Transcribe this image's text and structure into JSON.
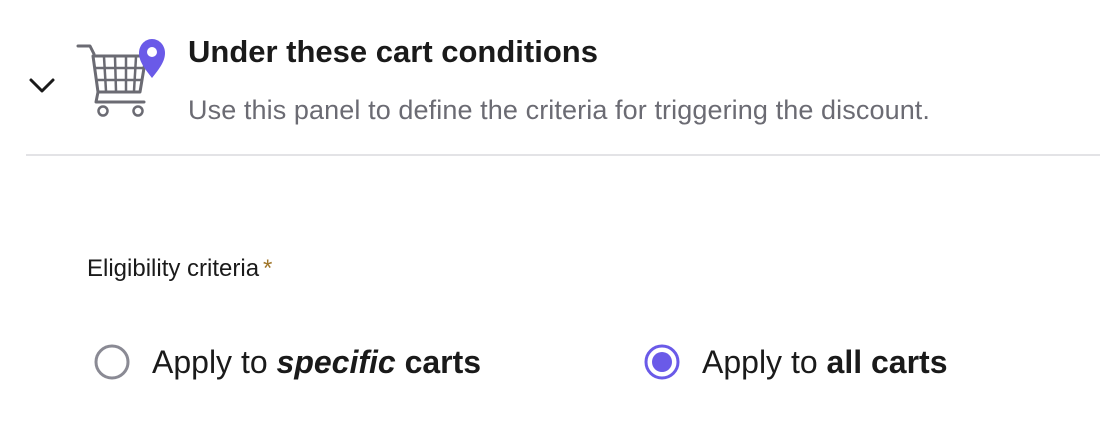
{
  "section": {
    "title": "Under these cart conditions",
    "subtitle": "Use this panel to define the criteria for triggering the discount.",
    "expanded": true,
    "icon": "shopping-cart-location-icon",
    "toggle_icon": "chevron-down-icon"
  },
  "eligibility": {
    "label": "Eligibility criteria",
    "required_mark": "*",
    "options": [
      {
        "id": "specific",
        "prefix": "Apply to ",
        "emphasis": "specific",
        "suffix": " carts",
        "selected": false
      },
      {
        "id": "all",
        "prefix": "Apply to ",
        "emphasis": "all carts",
        "suffix": "",
        "selected": true
      }
    ]
  },
  "colors": {
    "accent": "#6a5ae8",
    "radio_border_unselected": "#8a8a94",
    "text": "#1a1a1a",
    "muted_text": "#6b6b73",
    "required": "#a0762a",
    "divider": "#e3e3e6"
  }
}
